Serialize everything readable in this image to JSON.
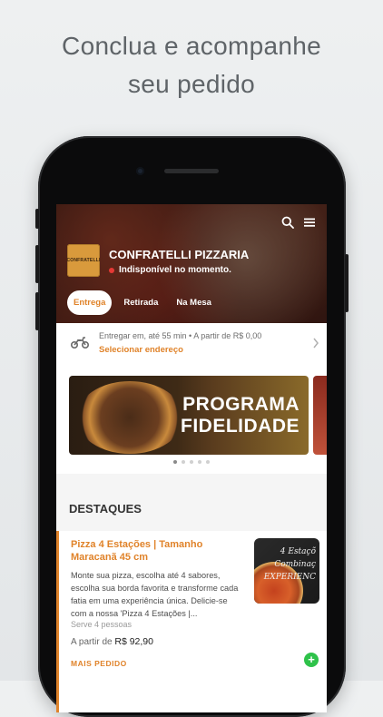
{
  "headline": {
    "line1": "Conclua e acompanhe",
    "line2": "seu pedido"
  },
  "store": {
    "logo_text": "CONFRATELLI",
    "name": "CONFRATELLI PIZZARIA",
    "status": "Indisponível no momento.",
    "status_color": "#e53935"
  },
  "tabs": [
    {
      "label": "Entrega",
      "active": true
    },
    {
      "label": "Retirada",
      "active": false
    },
    {
      "label": "Na Mesa",
      "active": false
    }
  ],
  "delivery": {
    "info": "Entregar em, até 55 min  •  A partir de R$ 0,00",
    "address_link": "Selecionar endereço"
  },
  "banner": {
    "line1": "PROGRAMA",
    "line2": "FIDELIDADE"
  },
  "carousel": {
    "count": 5,
    "active_index": 0
  },
  "highlights": {
    "title": "DESTAQUES",
    "product": {
      "title": "Pizza 4 Estações | Tamanho Maracanã 45 cm",
      "description": "Monte sua pizza, escolha até 4 sabores, escolha sua borda favorita e transforme cada fatia em uma experiência única. Delicie-se com a nossa 'Pizza 4 Estações |...",
      "serves": "Serve 4 pessoas",
      "price_prefix": "A partir de",
      "price": "R$ 92,90",
      "badge": "MAIS PEDIDO",
      "image_text_1": "4 Estaçõ",
      "image_text_2": "Combinaç",
      "image_text_3": "EXPERIENC",
      "add_label": "+"
    }
  },
  "colors": {
    "accent": "#e0832a",
    "add_button": "#2ec24a"
  },
  "icons": [
    "search-icon",
    "menu-icon",
    "motorcycle-icon",
    "chevron-right-icon"
  ]
}
